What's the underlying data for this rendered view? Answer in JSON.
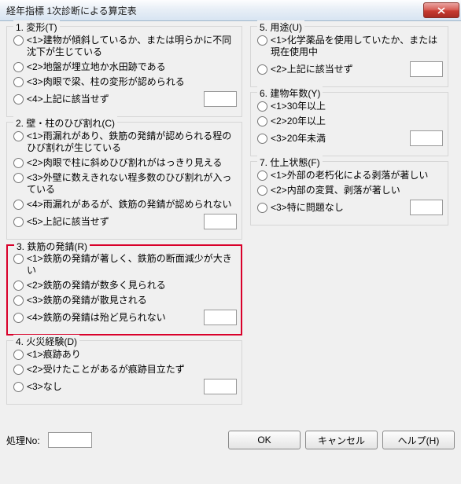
{
  "window_title": "経年指標 1次診断による算定表",
  "footer": {
    "proc_label": "処理No:",
    "ok": "OK",
    "cancel": "キャンセル",
    "help": "ヘルプ(H)"
  },
  "groups": {
    "g1": {
      "legend": "1. 変形(T)",
      "opts": [
        "<1>建物が傾斜しているか、または明らかに不同沈下が生じている",
        "<2>地盤が埋立地か水田跡である",
        "<3>肉眼で梁、柱の変形が認められる",
        "<4>上記に該当せず"
      ]
    },
    "g2": {
      "legend": "2. 壁・柱のひび割れ(C)",
      "opts": [
        "<1>雨漏れがあり、鉄筋の発錆が認められる程のひび割れが生じている",
        "<2>肉眼で柱に斜めひび割れがはっきり見える",
        "<3>外壁に数えきれない程多数のひび割れが入っている",
        "<4>雨漏れがあるが、鉄筋の発錆が認められない",
        "<5>上記に該当せず"
      ]
    },
    "g3": {
      "legend": "3. 鉄筋の発錆(R)",
      "opts": [
        "<1>鉄筋の発錆が著しく、鉄筋の断面減少が大きい",
        "<2>鉄筋の発錆が数多く見られる",
        "<3>鉄筋の発錆が散見される",
        "<4>鉄筋の発錆は殆ど見られない"
      ]
    },
    "g4": {
      "legend": "4. 火災経験(D)",
      "opts": [
        "<1>痕跡あり",
        "<2>受けたことがあるが痕跡目立たず",
        "<3>なし"
      ]
    },
    "g5": {
      "legend": "5. 用途(U)",
      "opts": [
        "<1>化学薬品を使用していたか、または現在使用中",
        "<2>上記に該当せず"
      ]
    },
    "g6": {
      "legend": "6. 建物年数(Y)",
      "opts": [
        "<1>30年以上",
        "<2>20年以上",
        "<3>20年未満"
      ]
    },
    "g7": {
      "legend": "7. 仕上状態(F)",
      "opts": [
        "<1>外部の老朽化による剥落が著しい",
        "<2>内部の変質、剥落が著しい",
        "<3>特に問題なし"
      ]
    }
  }
}
